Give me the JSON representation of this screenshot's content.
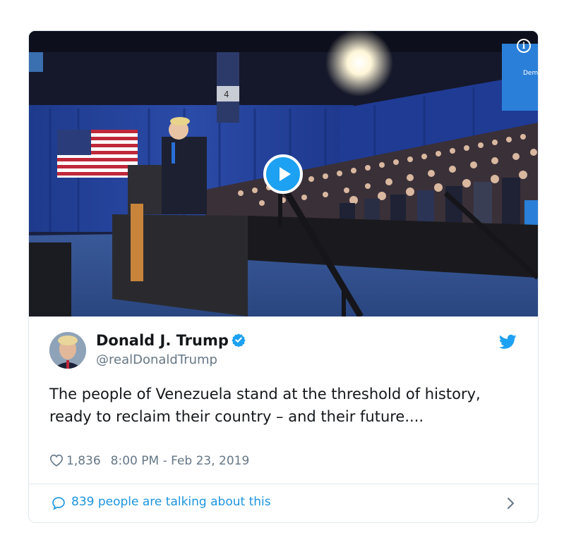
{
  "tweet": {
    "author_name": "Donald J. Trump",
    "handle": "@realDonaldTrump",
    "verified": true,
    "text": "The people of Venezuela stand at the threshold of history, ready to reclaim their country – and their future....",
    "likes": "1,836",
    "timestamp": "8:00 PM - Feb 23, 2019"
  },
  "media": {
    "type": "video",
    "info_glyph": "i",
    "podium_number": "4",
    "screen_text": "Dem"
  },
  "footer": {
    "talking_label": "839 people are talking about this"
  },
  "colors": {
    "twitter_blue": "#1da1f2",
    "link_blue": "#1b95e0",
    "text_dark": "#14171a",
    "text_gray": "#657786",
    "border": "#e1e8ed"
  },
  "icons": [
    "info-icon",
    "play-icon",
    "verified-icon",
    "twitter-bird-icon",
    "heart-icon",
    "speech-bubble-icon",
    "chevron-right-icon"
  ]
}
